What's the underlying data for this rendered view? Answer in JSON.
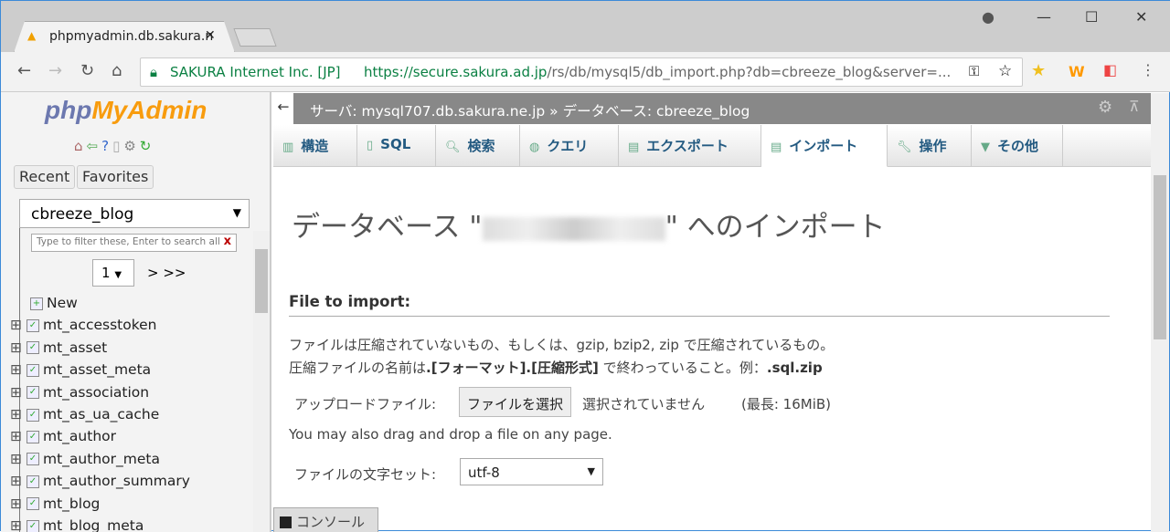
{
  "browser": {
    "tab_title": "phpmyadmin.db.sakura.n",
    "security_label": "SAKURA Internet Inc. [JP]",
    "url_host": "https://secure.sakura.ad.jp",
    "url_path": "/rs/db/mysql5/db_import.php?db=cbreeze_blog&server=..."
  },
  "sidebar": {
    "logo_php": "php",
    "logo_myadmin": "MyAdmin",
    "recent": "Recent",
    "favorites": "Favorites",
    "database": "cbreeze_blog",
    "filter_placeholder": "Type to filter these, Enter to search all",
    "filter_clear": "x",
    "page": "1",
    "page_next": "> >>",
    "tables": [
      "New",
      "mt_accesstoken",
      "mt_asset",
      "mt_asset_meta",
      "mt_association",
      "mt_as_ua_cache",
      "mt_author",
      "mt_author_meta",
      "mt_author_summary",
      "mt_blog",
      "mt_blog_meta"
    ]
  },
  "breadcrumb": {
    "server": "サーバ: mysql707.db.sakura.ne.jp",
    "sep": "»",
    "database": "データベース: cbreeze_blog"
  },
  "tabs": [
    {
      "label": "構造",
      "icon": "structure-icon"
    },
    {
      "label": "SQL",
      "icon": "sql-icon"
    },
    {
      "label": "検索",
      "icon": "search-icon"
    },
    {
      "label": "クエリ",
      "icon": "query-icon"
    },
    {
      "label": "エクスポート",
      "icon": "export-icon"
    },
    {
      "label": "インポート",
      "icon": "import-icon",
      "active": true
    },
    {
      "label": "操作",
      "icon": "wrench-icon"
    },
    {
      "label": "その他",
      "icon": "chevron-down-icon"
    }
  ],
  "main": {
    "title_prefix": "データベース \"",
    "title_suffix": "\" へのインポート",
    "section": "File to import:",
    "desc1": "ファイルは圧縮されていないもの、もしくは、gzip, bzip2, zip で圧縮されているもの。",
    "desc2a": "圧縮ファイルの名前は",
    "desc2b": ".[フォーマット].[圧縮形式]",
    "desc2c": " で終わっていること。例：",
    "desc2d": ".sql.zip",
    "upload_label": "アップロードファイル:",
    "choose_button": "ファイルを選択",
    "no_file": "選択されていません",
    "max_size": "(最長: 16MiB)",
    "drag_note": "You may also drag and drop a file on any page.",
    "charset_label": "ファイルの文字セット:",
    "charset_value": "utf-8",
    "console": "コンソール"
  }
}
